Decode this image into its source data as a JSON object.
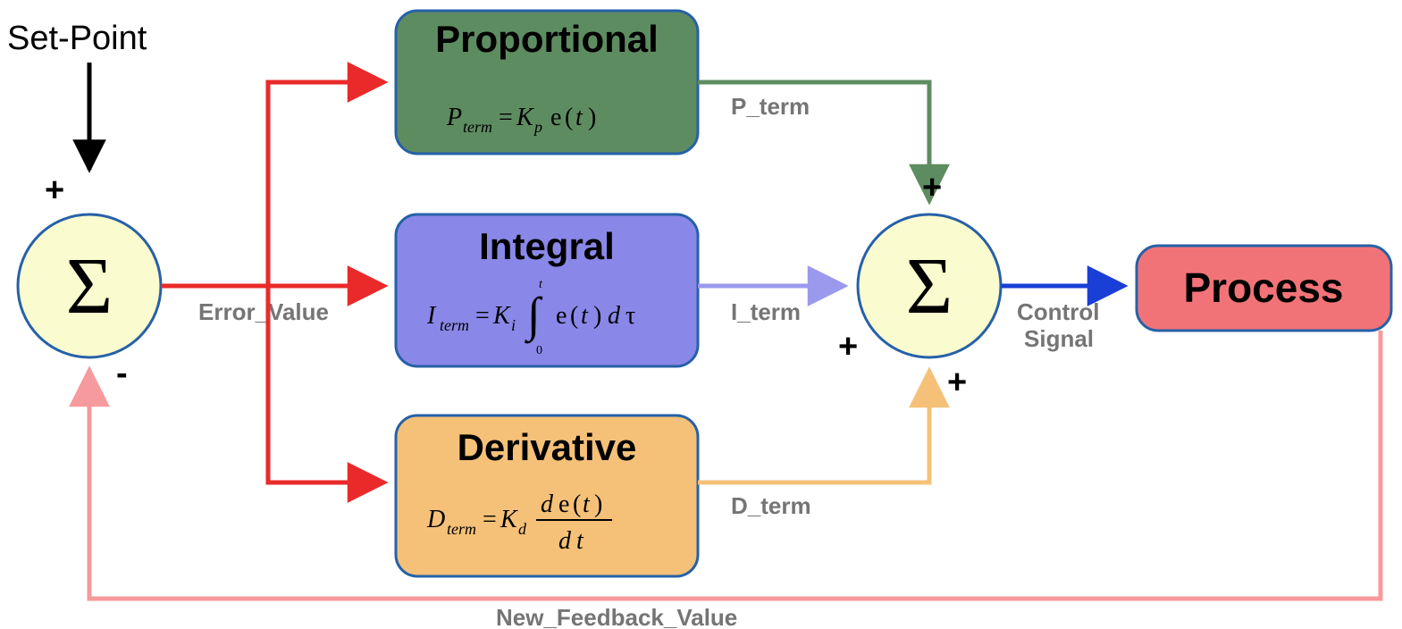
{
  "labels": {
    "setpoint": "Set-Point",
    "error": "Error_Value",
    "p_term": "P_term",
    "i_term": "I_term",
    "d_term": "D_term",
    "control1": "Control",
    "control2": "Signal",
    "feedback": "New_Feedback_Value"
  },
  "blocks": {
    "proportional": "Proportional",
    "integral": "Integral",
    "derivative": "Derivative",
    "process": "Process"
  },
  "signs": {
    "sum1_plus": "+",
    "sum1_minus": "-",
    "sum2_top": "+",
    "sum2_left": "+",
    "sum2_bottom": "+"
  },
  "colors": {
    "proportional_fill": "#5e8c61",
    "integral_fill": "#8988e8",
    "derivative_fill": "#f5c178",
    "process_fill": "#f27377",
    "outline": "#2661a8",
    "error_red": "#ea2a2a",
    "p_line": "#5e8c61",
    "i_line": "#9a99ed",
    "d_line": "#f5c178",
    "control_blue": "#1a3fd6",
    "feedback_pink": "#f79a9d",
    "sum_fill": "#fafbce"
  }
}
